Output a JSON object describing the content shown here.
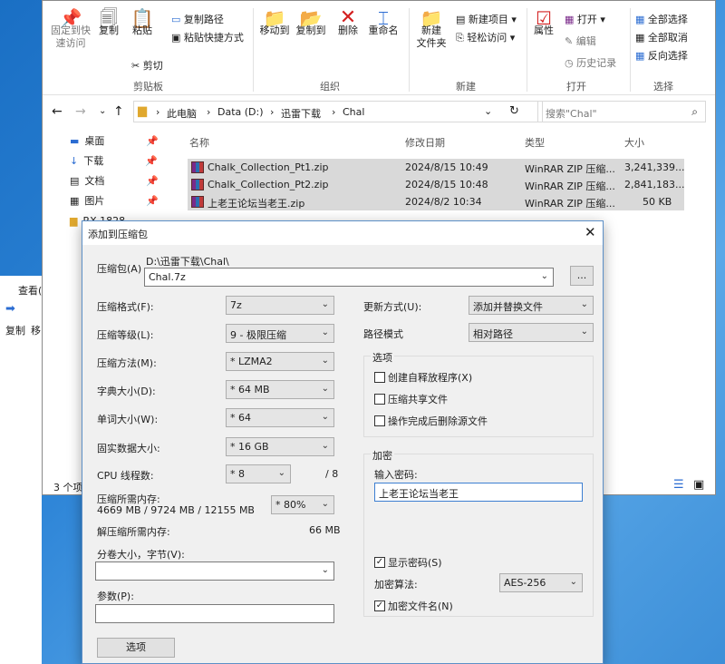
{
  "ribbon": {
    "pin_label": "固定到快\n速访问",
    "copy_label": "复制",
    "paste_label": "粘贴",
    "copy_path": "复制路径",
    "paste_shortcut": "粘贴快捷方式",
    "cut": "剪切",
    "clipboard_group": "剪贴板",
    "move_to": "移动到",
    "copy_to": "复制到",
    "delete": "删除",
    "rename": "重命名",
    "organize_group": "组织",
    "new_folder": "新建\n文件夹",
    "new_item": "新建项目",
    "easy_access": "轻松访问",
    "new_group": "新建",
    "properties": "属性",
    "open": "打开",
    "edit": "编辑",
    "history": "历史记录",
    "open_group": "打开",
    "select_all": "全部选择",
    "select_none": "全部取消",
    "invert": "反向选择",
    "select_group": "选择"
  },
  "address": {
    "crumbs": [
      "此电脑",
      "Data (D:)",
      "迅雷下载",
      "Chal"
    ],
    "search_placeholder": "搜索\"Chal\""
  },
  "nav_items": [
    "桌面",
    "下载",
    "文档",
    "图片",
    "RX-1828"
  ],
  "columns": {
    "name": "名称",
    "date": "修改日期",
    "type": "类型",
    "size": "大小"
  },
  "files": [
    {
      "name": "Chalk_Collection_Pt1.zip",
      "date": "2024/8/15 10:49",
      "type": "WinRAR ZIP 压缩...",
      "size": "3,241,339..."
    },
    {
      "name": "Chalk_Collection_Pt2.zip",
      "date": "2024/8/15 10:48",
      "type": "WinRAR ZIP 压缩...",
      "size": "2,841,183..."
    },
    {
      "name": "上老王论坛当老王.zip",
      "date": "2024/8/2 10:34",
      "type": "WinRAR ZIP 压缩...",
      "size": "50 KB"
    }
  ],
  "status": "3 个项",
  "bg_window": {
    "view_label": "查看(",
    "copy": "复制",
    "move": "移"
  },
  "dialog": {
    "title": "添加到压缩包",
    "archive_label": "压缩包(A)",
    "archive_path": "D:\\迅雷下载\\Chal\\",
    "archive_name": "Chal.7z",
    "browse": "...",
    "format_label": "压缩格式(F):",
    "format_value": "7z",
    "level_label": "压缩等级(L):",
    "level_value": "9 - 极限压缩",
    "method_label": "压缩方法(M):",
    "method_value": "* LZMA2",
    "dict_label": "字典大小(D):",
    "dict_value": "* 64 MB",
    "word_label": "单词大小(W):",
    "word_value": "* 64",
    "solid_label": "固实数据大小:",
    "solid_value": "* 16 GB",
    "cpu_label": "CPU 线程数:",
    "cpu_value": "* 8",
    "cpu_total": "/ 8",
    "mem_label": "压缩所需内存:",
    "mem_value": "4669 MB / 9724 MB / 12155 MB",
    "mem_percent": "* 80%",
    "decomp_label": "解压缩所需内存:",
    "decomp_value": "66 MB",
    "split_label": "分卷大小，字节(V):",
    "params_label": "参数(P):",
    "options_btn": "选项",
    "update_label": "更新方式(U):",
    "update_value": "添加并替换文件",
    "path_label": "路径模式",
    "path_value": "相对路径",
    "options_group": "选项",
    "opt_sfx": "创建自释放程序(X)",
    "opt_shared": "压缩共享文件",
    "opt_delete": "操作完成后删除源文件",
    "enc_group": "加密",
    "pwd_label": "输入密码:",
    "pwd_value": "上老王论坛当老王",
    "show_pwd": "显示密码(S)",
    "enc_method_label": "加密算法:",
    "enc_method_value": "AES-256",
    "enc_names": "加密文件名(N)"
  }
}
